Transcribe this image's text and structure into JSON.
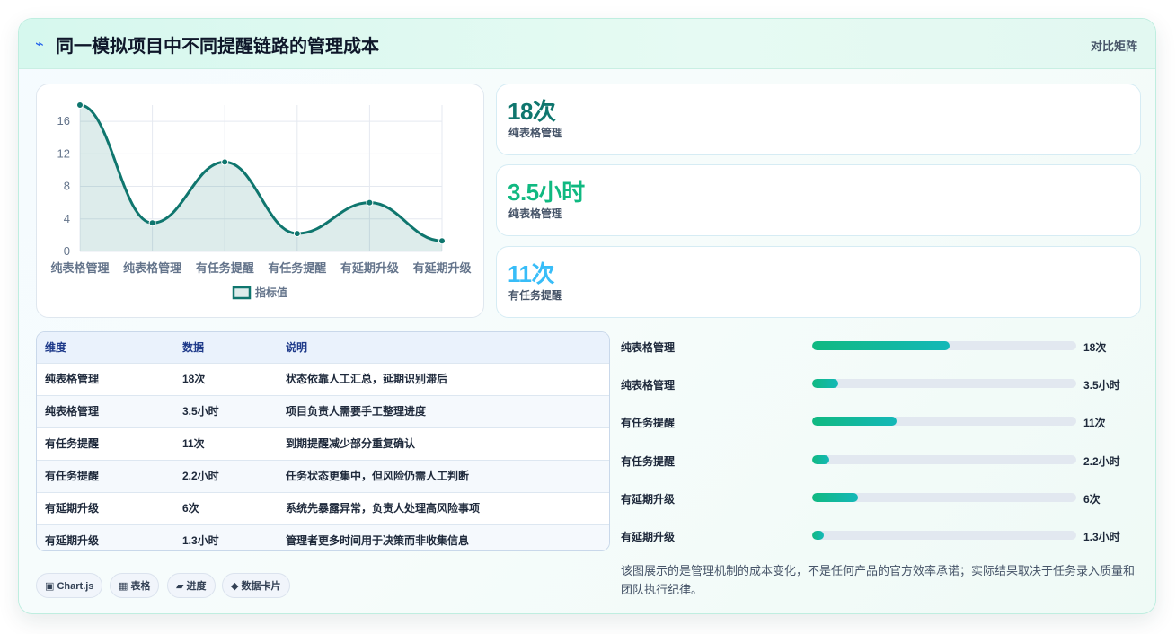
{
  "header": {
    "icon": "bolt-icon",
    "title": "同一模拟项目中不同提醒链路的管理成本",
    "right_label": "对比矩阵"
  },
  "chart_data": {
    "type": "line",
    "categories": [
      "纯表格管理",
      "纯表格管理",
      "有任务提醒",
      "有任务提醒",
      "有延期升级",
      "有延期升级"
    ],
    "series": [
      {
        "name": "指标值",
        "values": [
          18,
          3.5,
          11,
          2.2,
          6,
          1.3
        ],
        "color": "#0f766e"
      }
    ],
    "y_ticks": [
      0,
      4,
      8,
      12,
      16
    ],
    "ylim": [
      0,
      18
    ],
    "grid": true,
    "legend_position": "bottom",
    "fill": "area",
    "smooth": true
  },
  "stats": [
    {
      "value": "18次",
      "label": "纯表格管理",
      "color": "#0f766e"
    },
    {
      "value": "3.5小时",
      "label": "纯表格管理",
      "color": "#10b981"
    },
    {
      "value": "11次",
      "label": "有任务提醒",
      "color": "#38bdf8"
    }
  ],
  "table": {
    "headers": [
      "维度",
      "数据",
      "说明"
    ],
    "rows": [
      [
        "纯表格管理",
        "18次",
        "状态依靠人工汇总，延期识别滞后"
      ],
      [
        "纯表格管理",
        "3.5小时",
        "项目负责人需要手工整理进度"
      ],
      [
        "有任务提醒",
        "11次",
        "到期提醒减少部分重复确认"
      ],
      [
        "有任务提醒",
        "2.2小时",
        "任务状态更集中，但风险仍需人工判断"
      ],
      [
        "有延期升级",
        "6次",
        "系统先暴露异常，负责人处理高风险事项"
      ],
      [
        "有延期升级",
        "1.3小时",
        "管理者更多时间用于决策而非收集信息"
      ]
    ]
  },
  "bars": [
    {
      "label": "纯表格管理",
      "value": "18次",
      "level": 0.52
    },
    {
      "label": "纯表格管理",
      "value": "3.5小时",
      "level": 0.1
    },
    {
      "label": "有任务提醒",
      "value": "11次",
      "level": 0.32
    },
    {
      "label": "有任务提醒",
      "value": "2.2小时",
      "level": 0.065
    },
    {
      "label": "有延期升级",
      "value": "6次",
      "level": 0.175
    },
    {
      "label": "有延期升级",
      "value": "1.3小时",
      "level": 0.045
    }
  ],
  "tags": [
    {
      "icon": "▣",
      "label": "Chart.js"
    },
    {
      "icon": "▦",
      "label": "表格"
    },
    {
      "icon": "▰",
      "label": "进度"
    },
    {
      "icon": "◆",
      "label": "数据卡片"
    }
  ],
  "note": "该图展示的是管理机制的成本变化，不是任何产品的官方效率承诺；实际结果取决于任务录入质量和团队执行纪律。"
}
